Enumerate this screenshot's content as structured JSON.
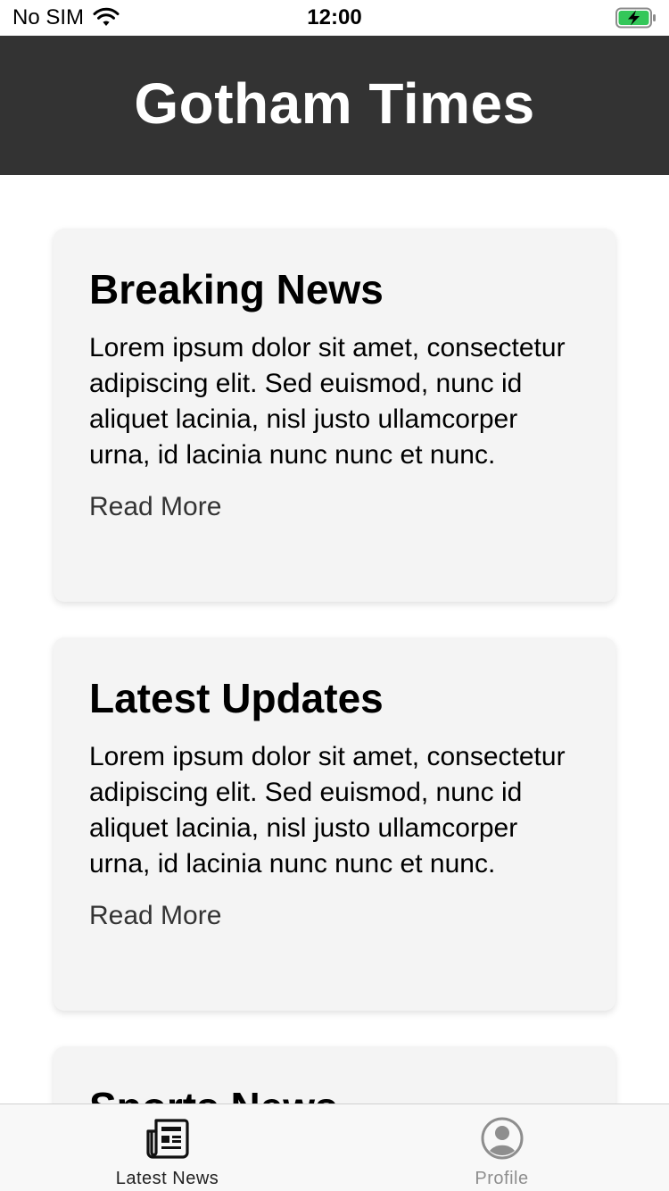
{
  "status_bar": {
    "carrier": "No SIM",
    "time": "12:00",
    "battery_color": "#34c759"
  },
  "header": {
    "title": "Gotham Times",
    "background": "#333333"
  },
  "articles": [
    {
      "title": "Breaking News",
      "body": "Lorem ipsum dolor sit amet, consectetur adipiscing elit. Sed euismod, nunc id aliquet lacinia, nisl justo ullamcorper urna, id lacinia nunc nunc et nunc.",
      "link": "Read More"
    },
    {
      "title": "Latest Updates",
      "body": "Lorem ipsum dolor sit amet, consectetur adipiscing elit. Sed euismod, nunc id aliquet lacinia, nisl justo ullamcorper urna, id lacinia nunc nunc et nunc.",
      "link": "Read More"
    },
    {
      "title": "Sports News"
    }
  ],
  "tab_bar": {
    "tabs": [
      {
        "label": "Latest News",
        "icon": "newspaper-icon",
        "active": true
      },
      {
        "label": "Profile",
        "icon": "profile-icon",
        "active": false
      }
    ]
  }
}
